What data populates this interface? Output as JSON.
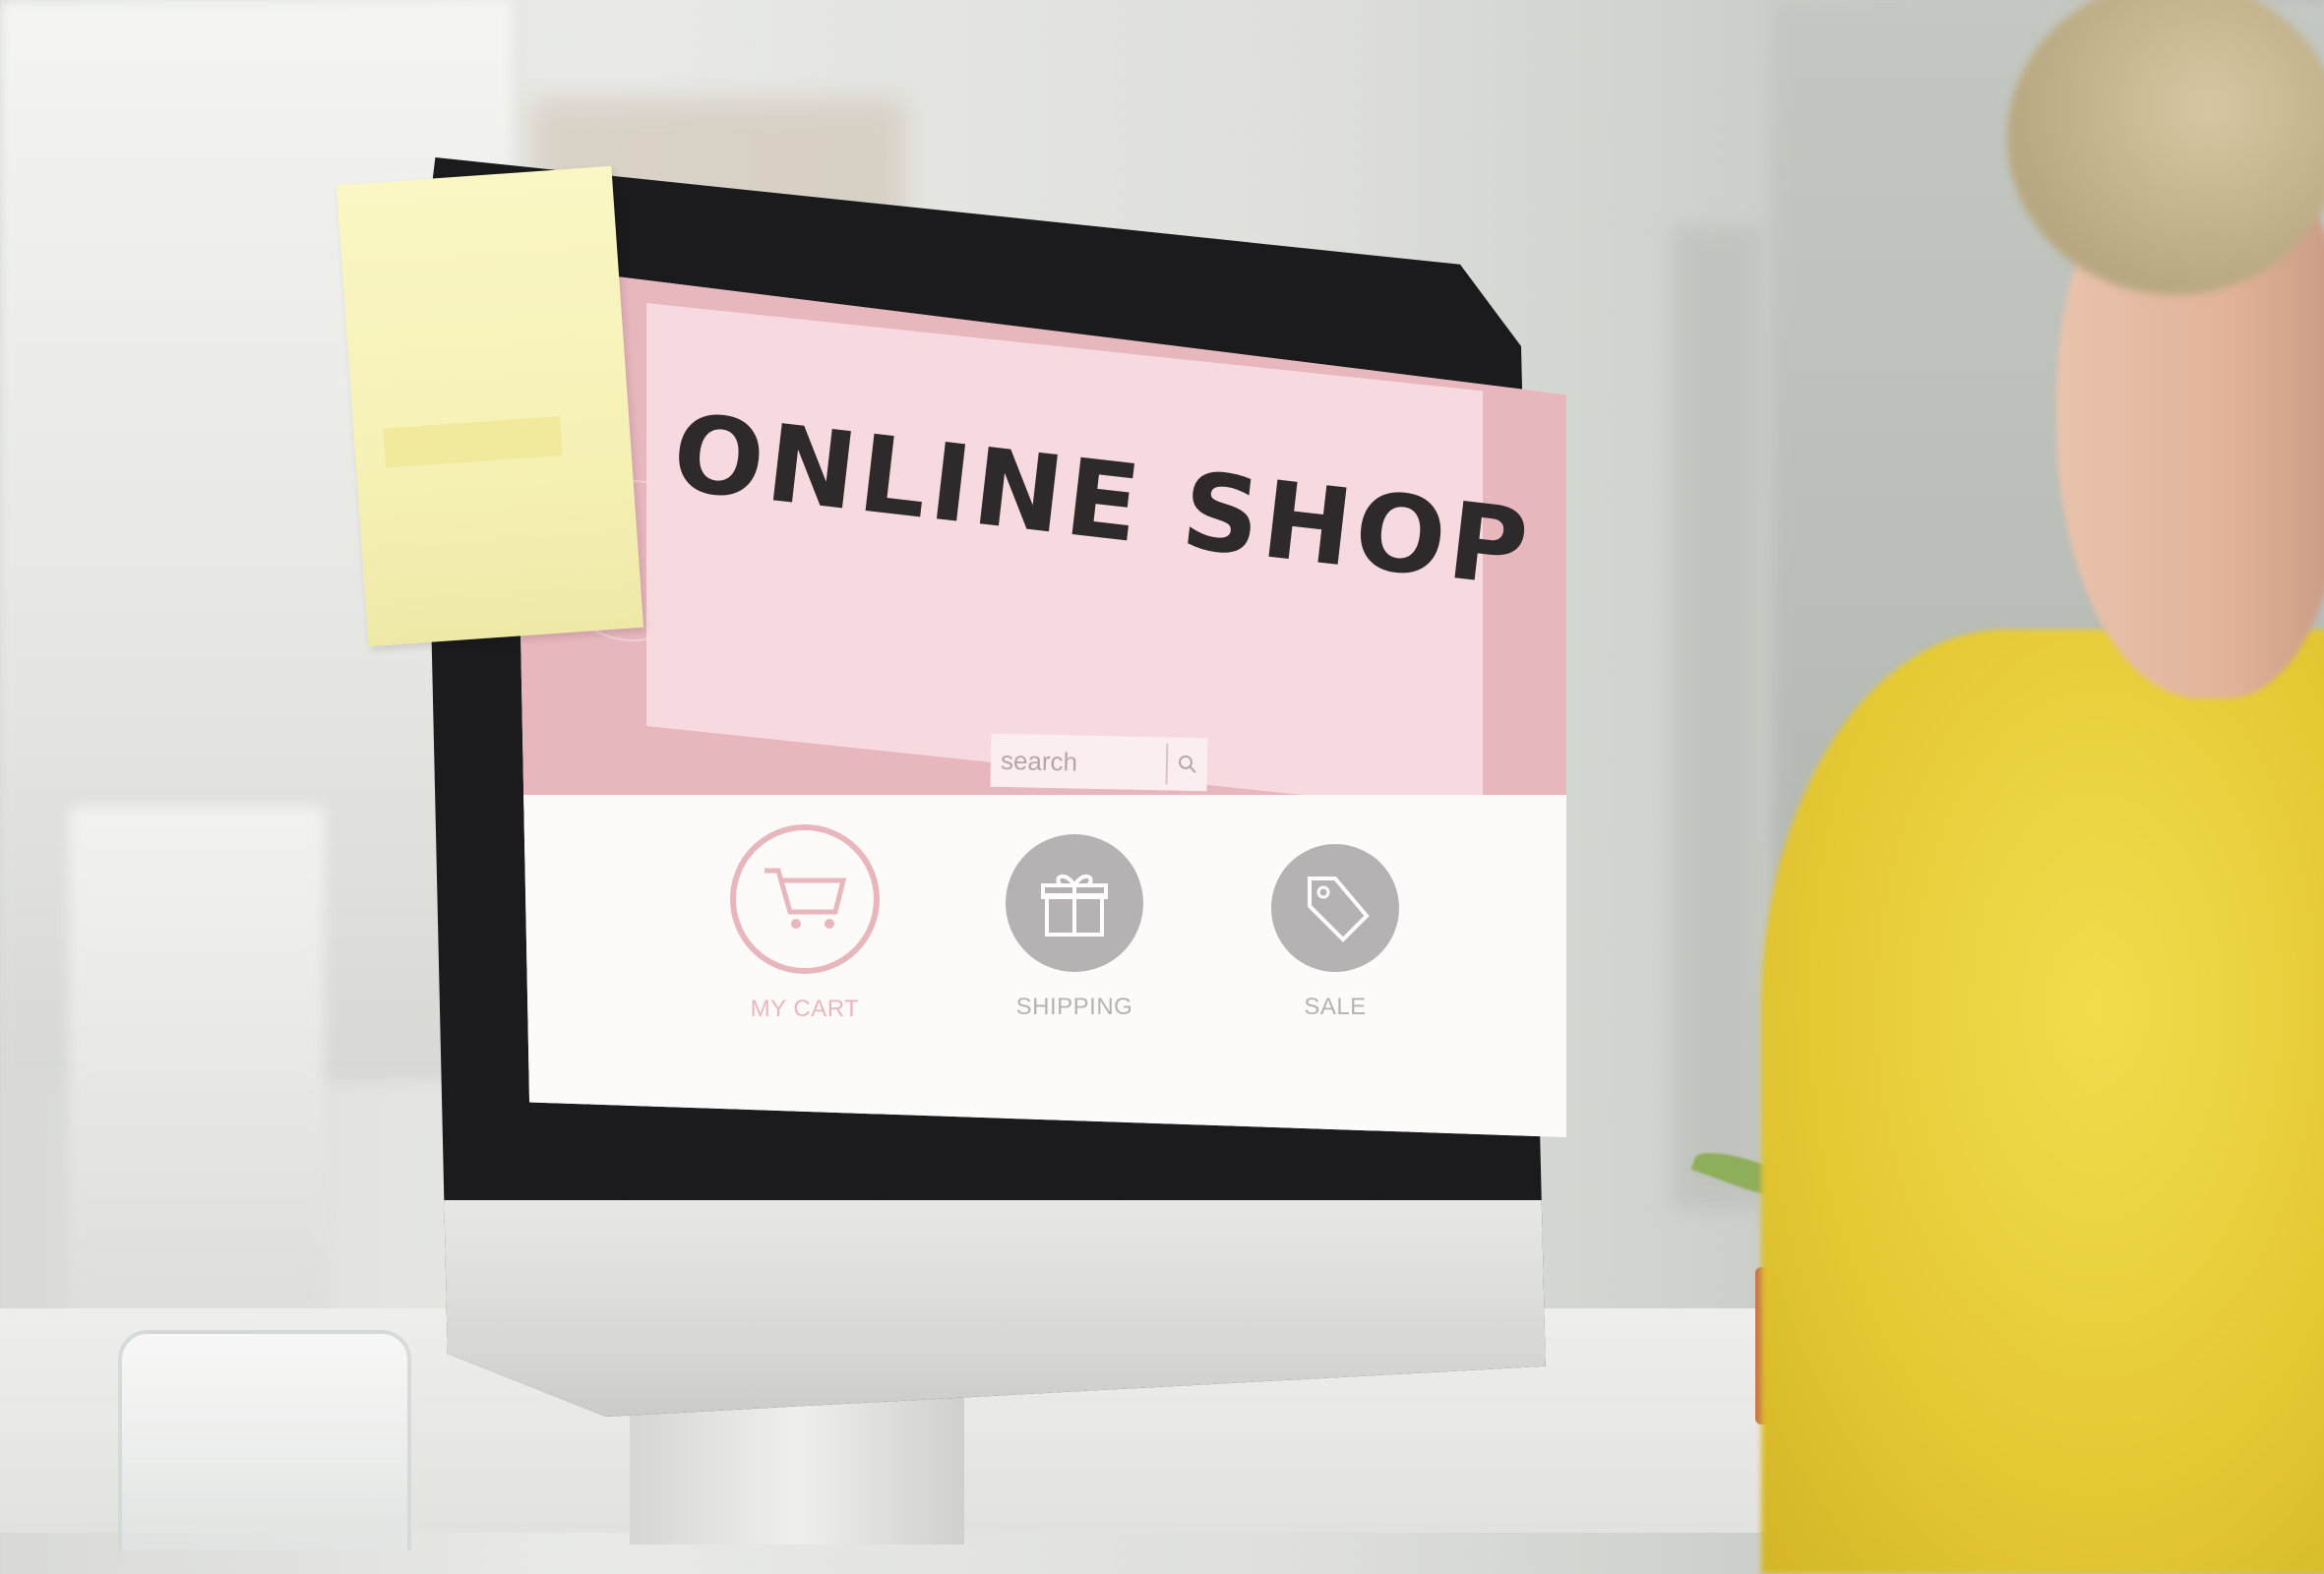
{
  "scene": {
    "description_colors": {
      "screen_pink": "#e8b6bd",
      "banner_pink": "#f7dadf",
      "sweater": "#e5c933",
      "sticky_note": "#f6f1b6"
    }
  },
  "shop": {
    "title": "ONLINE SHOP",
    "search": {
      "placeholder": "search",
      "icon": "search-icon"
    },
    "features": [
      {
        "label": "MY CART",
        "icon": "shopping-cart-icon",
        "color": "#e8b6bd"
      },
      {
        "label": "SHIPPING",
        "icon": "gift-box-icon",
        "color": "#b6b1b2"
      },
      {
        "label": "SALE",
        "icon": "price-tag-icon",
        "color": "#b6b1b2"
      }
    ]
  }
}
